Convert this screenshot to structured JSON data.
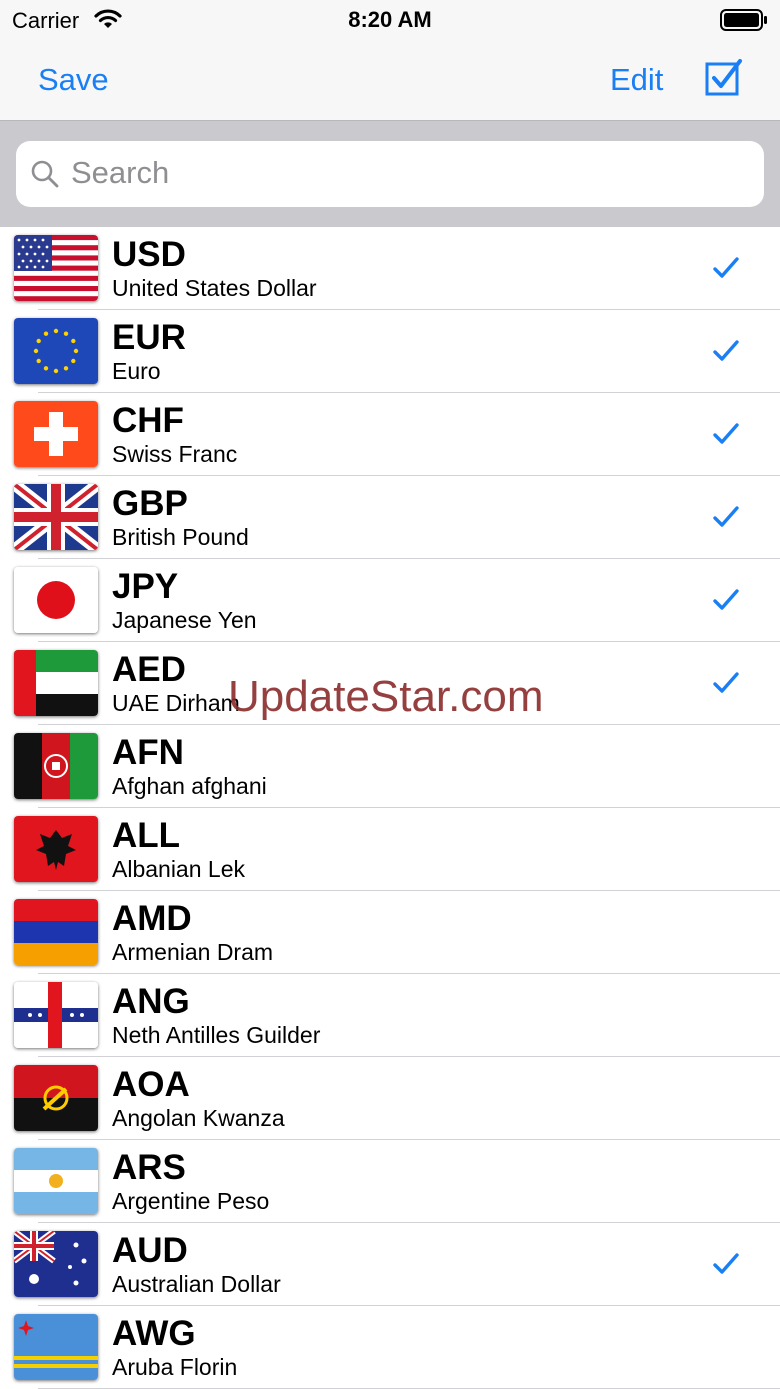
{
  "status_bar": {
    "carrier": "Carrier",
    "time": "8:20 AM"
  },
  "nav": {
    "save_label": "Save",
    "edit_label": "Edit"
  },
  "search": {
    "placeholder": "Search"
  },
  "colors": {
    "accent": "#1a7ff5"
  },
  "currencies": [
    {
      "code": "USD",
      "name": "United States Dollar",
      "checked": true
    },
    {
      "code": "EUR",
      "name": "Euro",
      "checked": true
    },
    {
      "code": "CHF",
      "name": "Swiss Franc",
      "checked": true
    },
    {
      "code": "GBP",
      "name": "British Pound",
      "checked": true
    },
    {
      "code": "JPY",
      "name": "Japanese Yen",
      "checked": true
    },
    {
      "code": "AED",
      "name": "UAE Dirham",
      "checked": true
    },
    {
      "code": "AFN",
      "name": "Afghan afghani",
      "checked": false
    },
    {
      "code": "ALL",
      "name": "Albanian Lek",
      "checked": false
    },
    {
      "code": "AMD",
      "name": "Armenian Dram",
      "checked": false
    },
    {
      "code": "ANG",
      "name": "Neth Antilles Guilder",
      "checked": false
    },
    {
      "code": "AOA",
      "name": "Angolan Kwanza",
      "checked": false
    },
    {
      "code": "ARS",
      "name": "Argentine Peso",
      "checked": false
    },
    {
      "code": "AUD",
      "name": "Australian Dollar",
      "checked": true
    },
    {
      "code": "AWG",
      "name": "Aruba Florin",
      "checked": false
    }
  ],
  "watermark": "UpdateStar.com"
}
